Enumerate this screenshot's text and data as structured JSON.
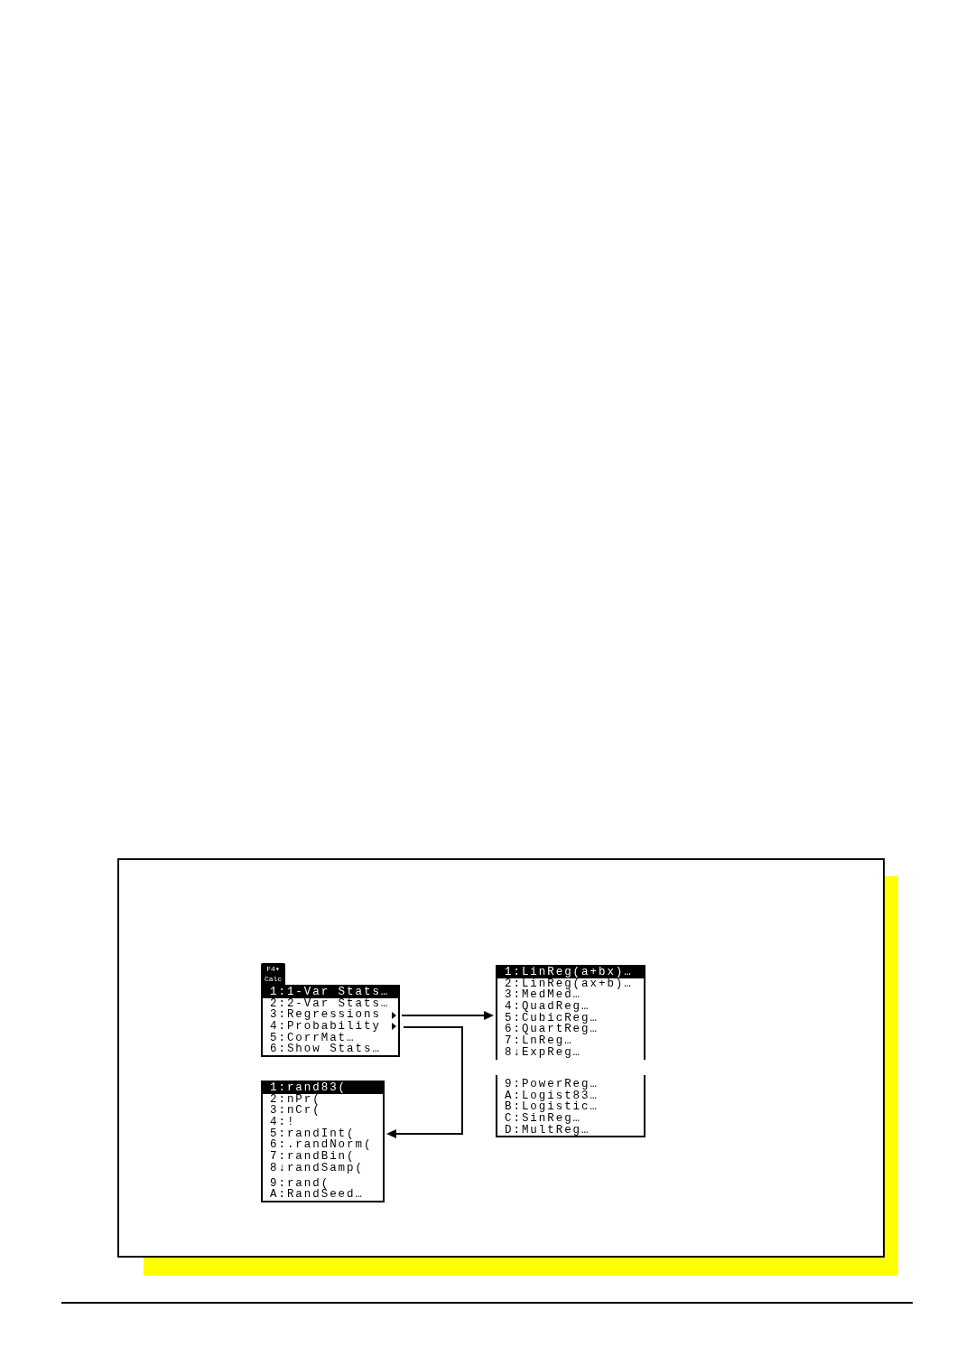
{
  "tab": {
    "key": "F4▾",
    "label": "Calc",
    "selected": true
  },
  "calc_menu": {
    "items": [
      {
        "label": "1:1-Var Stats…",
        "selected": true,
        "submenu": false
      },
      {
        "label": "2:2-Var Stats…",
        "selected": false,
        "submenu": false
      },
      {
        "label": "3:Regressions",
        "selected": false,
        "submenu": true
      },
      {
        "label": "4:Probability",
        "selected": false,
        "submenu": true
      },
      {
        "label": "5:CorrMat…",
        "selected": false,
        "submenu": false
      },
      {
        "label": "6:Show Stats…",
        "selected": false,
        "submenu": false
      }
    ]
  },
  "regressions_menu": {
    "split": true,
    "sections": [
      {
        "items": [
          {
            "label": "1:LinReg(a+bx)…",
            "selected": true
          },
          {
            "label": "2:LinReg(ax+b)…",
            "selected": false
          },
          {
            "label": "3:MedMed…",
            "selected": false
          },
          {
            "label": "4:QuadReg…",
            "selected": false
          },
          {
            "label": "5:CubicReg…",
            "selected": false
          },
          {
            "label": "6:QuartReg…",
            "selected": false
          },
          {
            "label": "7:LnReg…",
            "selected": false
          },
          {
            "label": "8↓ExpReg…",
            "selected": false
          }
        ]
      },
      {
        "items": [
          {
            "label": "9:PowerReg…",
            "selected": false
          },
          {
            "label": "A:Logist83…",
            "selected": false
          },
          {
            "label": "B:Logistic…",
            "selected": false
          },
          {
            "label": "C:SinReg…",
            "selected": false
          },
          {
            "label": "D:MultReg…",
            "selected": false
          }
        ]
      }
    ]
  },
  "probability_menu": {
    "split": false,
    "sections": [
      {
        "items": [
          {
            "label": "1:rand83(",
            "selected": true
          },
          {
            "label": "2:nPr(",
            "selected": false
          },
          {
            "label": "3:nCr(",
            "selected": false
          },
          {
            "label": "4:!",
            "selected": false
          },
          {
            "label": "5:randInt(",
            "selected": false
          },
          {
            "label": "6:.randNorm(",
            "selected": false
          },
          {
            "label": "7:randBin(",
            "selected": false
          },
          {
            "label": "8↓randSamp(",
            "selected": false
          }
        ]
      },
      {
        "items": [
          {
            "label": "9:rand(",
            "selected": false
          },
          {
            "label": "A:RandSeed…",
            "selected": false
          }
        ]
      }
    ]
  }
}
